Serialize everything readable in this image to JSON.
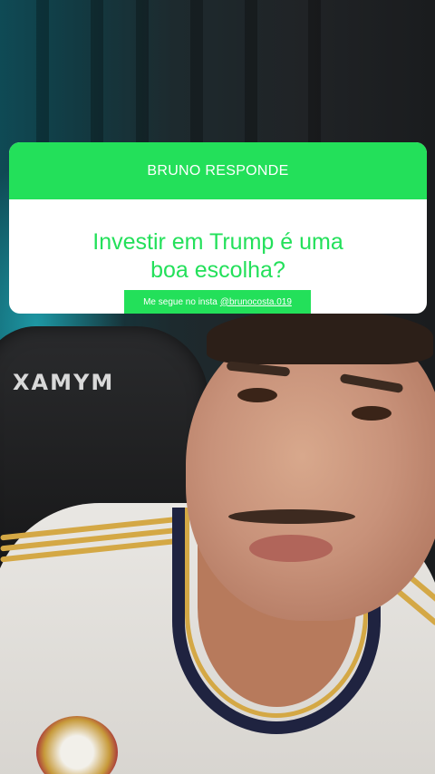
{
  "overlay": {
    "header_title": "BRUNO RESPONDE",
    "question_line1": "Investir em Trump é uma",
    "question_line2": "boa escolha?",
    "insta_prefix": "Me segue no insta",
    "insta_handle": "@brunocosta.019"
  },
  "video": {
    "chair_brand": "XAMYM"
  },
  "colors": {
    "accent_green": "#23e05a",
    "card_background": "#ffffff"
  }
}
